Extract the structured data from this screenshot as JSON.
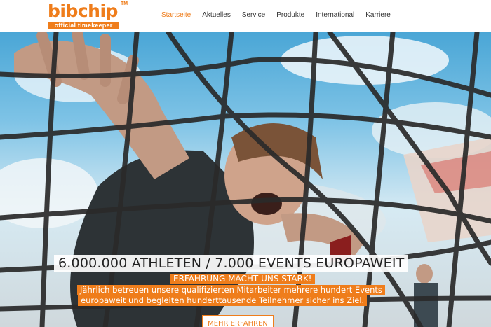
{
  "brand": {
    "name": "bibchip",
    "trademark": "TM",
    "tagline": "official timekeeper",
    "accent_color": "#ef7d1b"
  },
  "nav": {
    "items": [
      {
        "label": "Startseite",
        "active": true
      },
      {
        "label": "Aktuelles"
      },
      {
        "label": "Service"
      },
      {
        "label": "Produkte"
      },
      {
        "label": "International"
      },
      {
        "label": "Karriere"
      }
    ]
  },
  "hero": {
    "headline": "6.000.000 ATHLETEN / 7.000 EVENTS EUROPAWEIT",
    "subhead": "ERFAHRUNG MACHT UNS STARK!",
    "body_line1": "Jährlich betreuen unsere qualifizierten Mitarbeiter mehrere hundert Events",
    "body_line2": "europaweit und begleiten hunderttausende Teilnehmer sicher ins Ziel.",
    "cta_label": "MEHR ERFAHREN"
  }
}
